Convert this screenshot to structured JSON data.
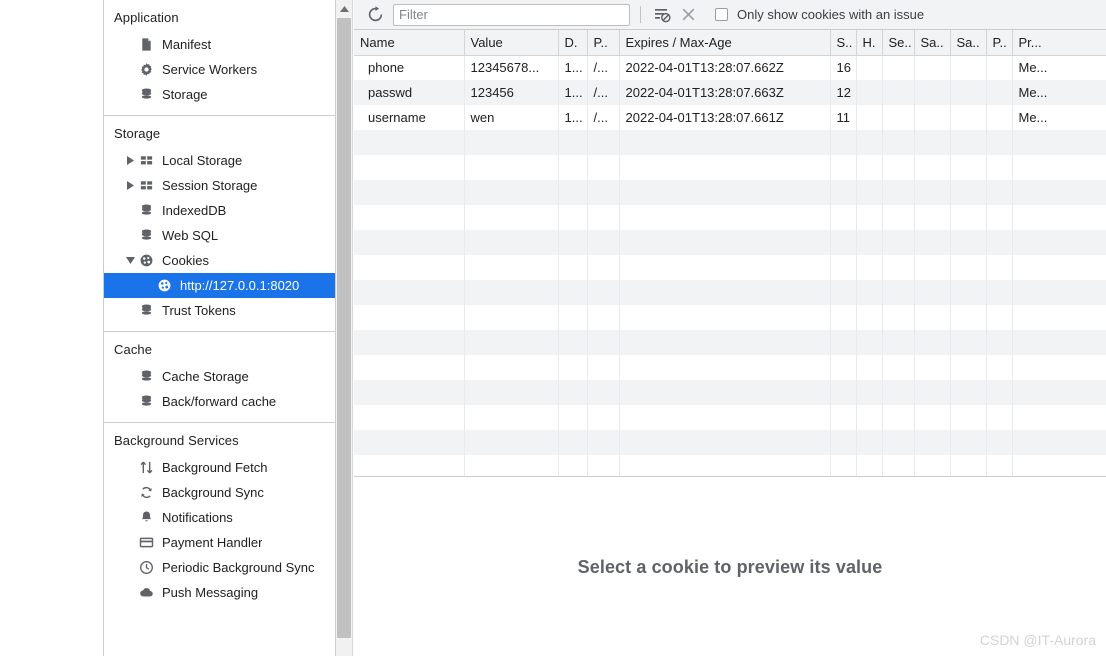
{
  "sidebar": {
    "sections": [
      {
        "title": "Application",
        "items": [
          {
            "label": "Manifest",
            "icon": "document-icon",
            "indent": 1,
            "arrow": "none",
            "selected": false
          },
          {
            "label": "Service Workers",
            "icon": "gear-icon",
            "indent": 1,
            "arrow": "none",
            "selected": false
          },
          {
            "label": "Storage",
            "icon": "database-icon",
            "indent": 1,
            "arrow": "none",
            "selected": false
          }
        ]
      },
      {
        "title": "Storage",
        "items": [
          {
            "label": "Local Storage",
            "icon": "table-grid-icon",
            "indent": 1,
            "arrow": "collapsed",
            "selected": false
          },
          {
            "label": "Session Storage",
            "icon": "table-grid-icon",
            "indent": 1,
            "arrow": "collapsed",
            "selected": false
          },
          {
            "label": "IndexedDB",
            "icon": "database-icon",
            "indent": 1,
            "arrow": "none",
            "selected": false
          },
          {
            "label": "Web SQL",
            "icon": "database-icon",
            "indent": 1,
            "arrow": "none",
            "selected": false
          },
          {
            "label": "Cookies",
            "icon": "cookie-icon",
            "indent": 1,
            "arrow": "expanded",
            "selected": false
          },
          {
            "label": "http://127.0.0.1:8020",
            "icon": "cookie-icon",
            "indent": 2,
            "arrow": "none",
            "selected": true
          },
          {
            "label": "Trust Tokens",
            "icon": "database-icon",
            "indent": 1,
            "arrow": "none",
            "selected": false
          }
        ]
      },
      {
        "title": "Cache",
        "items": [
          {
            "label": "Cache Storage",
            "icon": "database-icon",
            "indent": 1,
            "arrow": "none",
            "selected": false
          },
          {
            "label": "Back/forward cache",
            "icon": "database-icon",
            "indent": 1,
            "arrow": "none",
            "selected": false
          }
        ]
      },
      {
        "title": "Background Services",
        "items": [
          {
            "label": "Background Fetch",
            "icon": "arrows-updown-icon",
            "indent": 1,
            "arrow": "none",
            "selected": false
          },
          {
            "label": "Background Sync",
            "icon": "sync-icon",
            "indent": 1,
            "arrow": "none",
            "selected": false
          },
          {
            "label": "Notifications",
            "icon": "bell-icon",
            "indent": 1,
            "arrow": "none",
            "selected": false
          },
          {
            "label": "Payment Handler",
            "icon": "credit-card-icon",
            "indent": 1,
            "arrow": "none",
            "selected": false
          },
          {
            "label": "Periodic Background Sync",
            "icon": "clock-icon",
            "indent": 1,
            "arrow": "none",
            "selected": false
          },
          {
            "label": "Push Messaging",
            "icon": "cloud-icon",
            "indent": 1,
            "arrow": "none",
            "selected": false
          }
        ]
      }
    ],
    "selected_color": "#1a73e8"
  },
  "toolbar": {
    "refresh_icon": "refresh-icon",
    "filter_placeholder": "Filter",
    "filter_value": "",
    "clear_filtered_icon": "clear-filtered-cookies-icon",
    "delete_icon": "delete-selected-cookie-icon",
    "issues_checkbox_label": "Only show cookies with an issue",
    "issues_checkbox_checked": false
  },
  "table": {
    "columns": [
      "Name",
      "Value",
      "D.",
      "P..",
      "Expires / Max-Age",
      "S..",
      "H.",
      "Se..",
      "Sa..",
      "Sa..",
      "P..",
      "Pr..."
    ],
    "rows": [
      {
        "name": "phone",
        "value": "12345678...",
        "domain": "1...",
        "path": "/...",
        "expires": "2022-04-01T13:28:07.662Z",
        "size": "16",
        "httponly": "",
        "secure": "",
        "samesite": "",
        "samesite2": "",
        "partition": "",
        "priority": "Me..."
      },
      {
        "name": "passwd",
        "value": "123456",
        "domain": "1...",
        "path": "/...",
        "expires": "2022-04-01T13:28:07.663Z",
        "size": "12",
        "httponly": "",
        "secure": "",
        "samesite": "",
        "samesite2": "",
        "partition": "",
        "priority": "Me..."
      },
      {
        "name": "username",
        "value": "wen",
        "domain": "1...",
        "path": "/...",
        "expires": "2022-04-01T13:28:07.661Z",
        "size": "11",
        "httponly": "",
        "secure": "",
        "samesite": "",
        "samesite2": "",
        "partition": "",
        "priority": "Me..."
      }
    ]
  },
  "preview": {
    "empty_message": "Select a cookie to preview its value"
  },
  "watermark": {
    "text": "CSDN @IT-Aurora"
  }
}
